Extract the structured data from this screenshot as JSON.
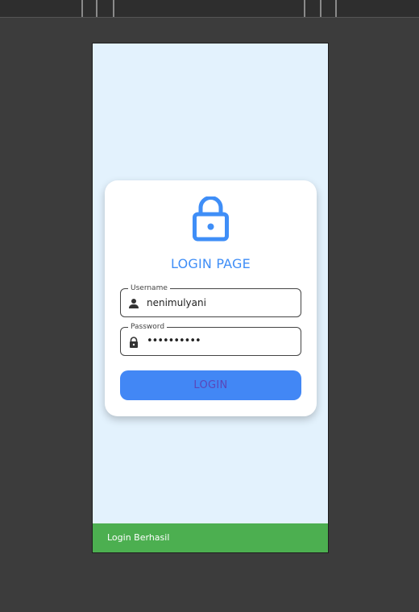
{
  "card": {
    "title": "LOGIN PAGE",
    "username": {
      "label": "Username",
      "value": "nenimulyani",
      "icon": "person-icon"
    },
    "password": {
      "label": "Password",
      "value": "••••••••••",
      "icon": "lock-small-icon"
    },
    "login_label": "LOGIN",
    "header_icon": "lock-icon"
  },
  "snackbar": {
    "message": "Login Berhasil"
  },
  "colors": {
    "accent": "#4287f5",
    "title": "#3f8ef7",
    "background": "#e3f2fd",
    "success": "#4caf50",
    "button_text": "#5a47b9"
  }
}
